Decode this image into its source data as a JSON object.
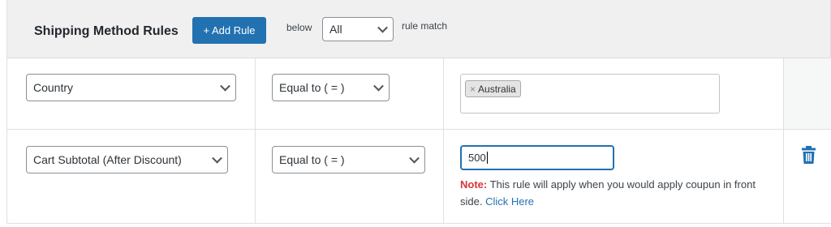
{
  "header": {
    "title": "Shipping Method Rules",
    "add_rule_label": "+ Add Rule",
    "below_label": "below",
    "match_value": "All",
    "rule_match_label": "rule match"
  },
  "rules": [
    {
      "field": "Country",
      "operator": "Equal to ( = )",
      "tags": [
        "Australia"
      ]
    },
    {
      "field": "Cart Subtotal (After Discount)",
      "operator": "Equal to ( = )",
      "value": "500",
      "note_label": "Note:",
      "note_text": " This rule will apply when you would apply coupun in front side. ",
      "note_link": "Click Here"
    }
  ],
  "colors": {
    "primary": "#2271b1",
    "note_red": "#d63638",
    "header_bg": "#f0f0f1"
  },
  "icons": {
    "remove_tag": "close-icon",
    "select_arrow": "chevron-down-icon",
    "delete": "trash-icon"
  }
}
